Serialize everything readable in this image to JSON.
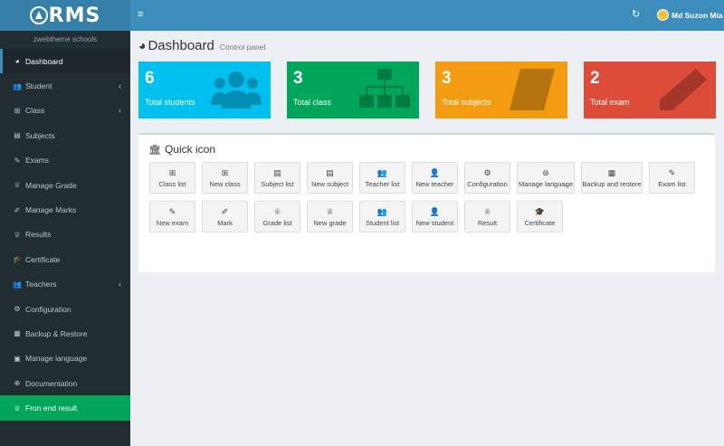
{
  "app": {
    "logo_text": "RMS",
    "school_name": "zwebtheme schools"
  },
  "sidebar": {
    "items": [
      {
        "label": "Dashboard",
        "icon": "dashboard-icon",
        "glyph": "◕"
      },
      {
        "label": "Student",
        "icon": "users-icon",
        "glyph": "👥",
        "chevron": "‹"
      },
      {
        "label": "Class",
        "icon": "sitemap-icon",
        "glyph": "⊞",
        "chevron": "‹"
      },
      {
        "label": "Subjects",
        "icon": "book-icon",
        "glyph": "▤"
      },
      {
        "label": "Exams",
        "icon": "pencil-icon",
        "glyph": "✎"
      },
      {
        "label": "Manage Grade",
        "icon": "trophy-icon",
        "glyph": "♕"
      },
      {
        "label": "Manage Marks",
        "icon": "edit-icon",
        "glyph": "✐"
      },
      {
        "label": "Results",
        "icon": "trophy-icon",
        "glyph": "♕"
      },
      {
        "label": "Certificate",
        "icon": "graduation-cap-icon",
        "glyph": "🎓"
      },
      {
        "label": "Teachers",
        "icon": "users-icon",
        "glyph": "👥",
        "chevron": "‹"
      },
      {
        "label": "Configuration",
        "icon": "gear-icon",
        "glyph": "⚙"
      },
      {
        "label": "Backup & Restore",
        "icon": "archive-icon",
        "glyph": "▦"
      },
      {
        "label": "Manage language",
        "icon": "language-icon",
        "glyph": "▣"
      },
      {
        "label": "Documentation",
        "icon": "globe-icon",
        "glyph": "⊕"
      },
      {
        "label": "Fron end result",
        "icon": "trophy-icon",
        "glyph": "♕"
      }
    ]
  },
  "header": {
    "menu_glyph": "≡",
    "refresh_glyph": "↻",
    "user_name": "Md Suzon Mia"
  },
  "page": {
    "title": "Dashboard",
    "subtitle": "Control panel",
    "title_glyph": "◕"
  },
  "stats": [
    {
      "value": "6",
      "label": "Total students",
      "color": "#00c0ef"
    },
    {
      "value": "3",
      "label": "Total class",
      "color": "#00a65a"
    },
    {
      "value": "3",
      "label": "Total subjects",
      "color": "#f39c12"
    },
    {
      "value": "2",
      "label": "Total exam",
      "color": "#dd4b39"
    }
  ],
  "quick": {
    "title": "Quick icon",
    "title_glyph": "🏛",
    "buttons": [
      {
        "label": "Class list",
        "glyph": "⊞"
      },
      {
        "label": "New class",
        "glyph": "⊞"
      },
      {
        "label": "Subject list",
        "glyph": "▤"
      },
      {
        "label": "New subject",
        "glyph": "▤"
      },
      {
        "label": "Teacher list",
        "glyph": "👥"
      },
      {
        "label": "New teacher",
        "glyph": "👤"
      },
      {
        "label": "Configuration",
        "glyph": "⚙"
      },
      {
        "label": "Manage language",
        "glyph": "⊛"
      },
      {
        "label": "Backup and restore",
        "glyph": "▦"
      },
      {
        "label": "Exam list",
        "glyph": "✎"
      },
      {
        "label": "New exam",
        "glyph": "✎"
      },
      {
        "label": "Mark",
        "glyph": "✐"
      },
      {
        "label": "Grade list",
        "glyph": "♕"
      },
      {
        "label": "New grade",
        "glyph": "♕"
      },
      {
        "label": "Student list",
        "glyph": "👥"
      },
      {
        "label": "New student",
        "glyph": "👤"
      },
      {
        "label": "Result",
        "glyph": "♕"
      },
      {
        "label": "Certificate",
        "glyph": "🎓"
      }
    ]
  }
}
